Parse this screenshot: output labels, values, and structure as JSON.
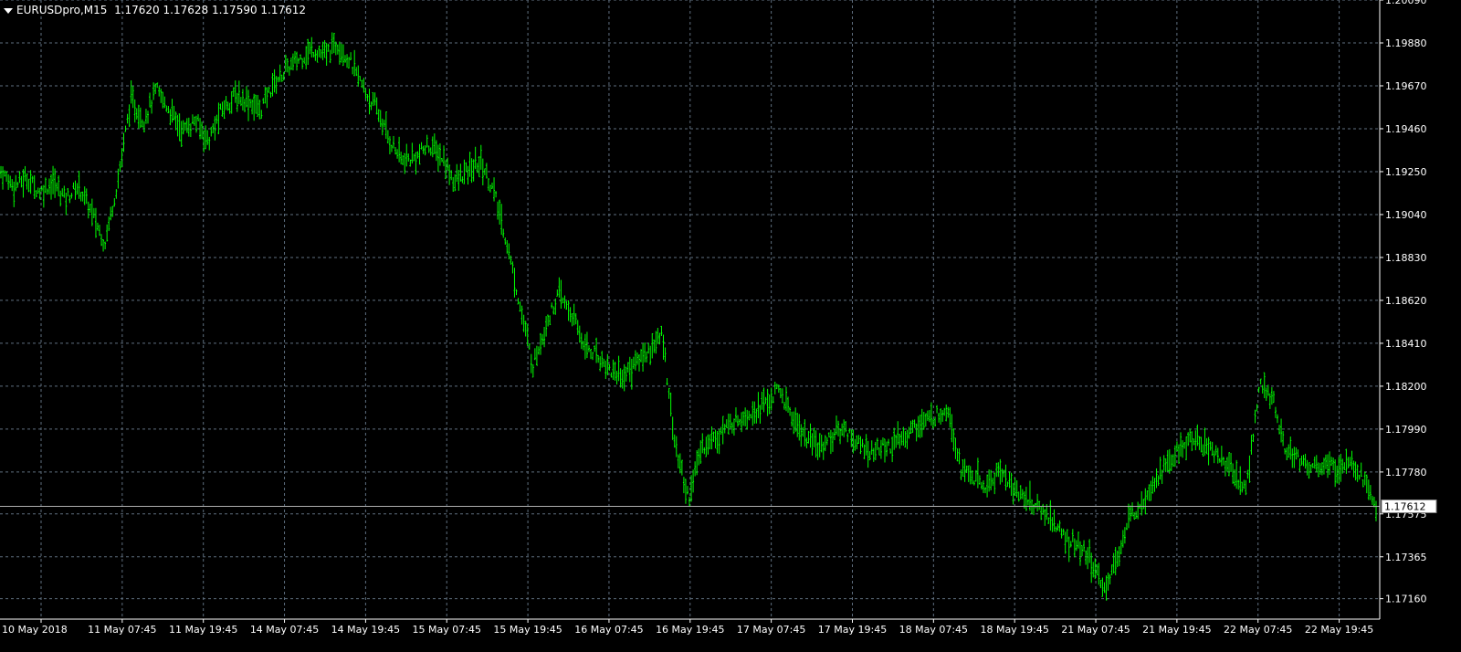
{
  "header": {
    "symbol": "EURUSDpro,M15",
    "open": "1.17620",
    "high": "1.17628",
    "low": "1.17590",
    "close": "1.17612"
  },
  "current_price_label": "1.17612",
  "colors": {
    "background": "#000000",
    "bars": "#00ff00",
    "grid": "#5f6f7f",
    "axis": "#ffffff",
    "price_line": "#b0b0b0"
  },
  "chart_data": {
    "type": "line",
    "title": "",
    "xlabel": "",
    "ylabel": "",
    "ylim": [
      1.1706,
      1.2009
    ],
    "y_ticks": [
      "1.20090",
      "1.19880",
      "1.19670",
      "1.19460",
      "1.19250",
      "1.19040",
      "1.18830",
      "1.18620",
      "1.18410",
      "1.18200",
      "1.17990",
      "1.17780",
      "1.17575",
      "1.17365",
      "1.17160"
    ],
    "x_ticks": [
      "10 May 2018",
      "11 May 07:45",
      "11 May 19:45",
      "14 May 07:45",
      "14 May 19:45",
      "15 May 07:45",
      "15 May 19:45",
      "16 May 07:45",
      "16 May 19:45",
      "17 May 07:45",
      "17 May 19:45",
      "18 May 07:45",
      "18 May 19:45",
      "21 May 07:45",
      "21 May 19:45",
      "22 May 07:45",
      "22 May 19:45"
    ],
    "grid": true,
    "series": [
      {
        "values": [
          1.1925,
          1.1918,
          1.1922,
          1.1915,
          1.192,
          1.1912,
          1.1918,
          1.1905,
          1.189,
          1.192,
          1.196,
          1.195,
          1.1965,
          1.1955,
          1.1945,
          1.195,
          1.194,
          1.1955,
          1.1962,
          1.196,
          1.1955,
          1.1968,
          1.1975,
          1.198,
          1.1985,
          1.1982,
          1.1988,
          1.1978,
          1.1965,
          1.1955,
          1.194,
          1.193,
          1.1932,
          1.1938,
          1.1932,
          1.192,
          1.1925,
          1.193,
          1.1915,
          1.189,
          1.186,
          1.183,
          1.185,
          1.1865,
          1.1855,
          1.184,
          1.1835,
          1.1828,
          1.1825,
          1.1832,
          1.1838,
          1.1845,
          1.179,
          1.1765,
          1.179,
          1.1795,
          1.18,
          1.1805,
          1.1808,
          1.1812,
          1.1818,
          1.1805,
          1.1795,
          1.179,
          1.1795,
          1.18,
          1.1792,
          1.1788,
          1.179,
          1.1792,
          1.1798,
          1.1802,
          1.1805,
          1.181,
          1.178,
          1.1775,
          1.177,
          1.178,
          1.177,
          1.1765,
          1.176,
          1.1755,
          1.1745,
          1.1742,
          1.1735,
          1.172,
          1.1735,
          1.1755,
          1.1765,
          1.1775,
          1.1782,
          1.179,
          1.1795,
          1.179,
          1.1785,
          1.1778,
          1.177,
          1.182,
          1.1815,
          1.179,
          1.1785,
          1.178,
          1.1782,
          1.178,
          1.1785,
          1.1775,
          1.1761
        ]
      }
    ]
  }
}
